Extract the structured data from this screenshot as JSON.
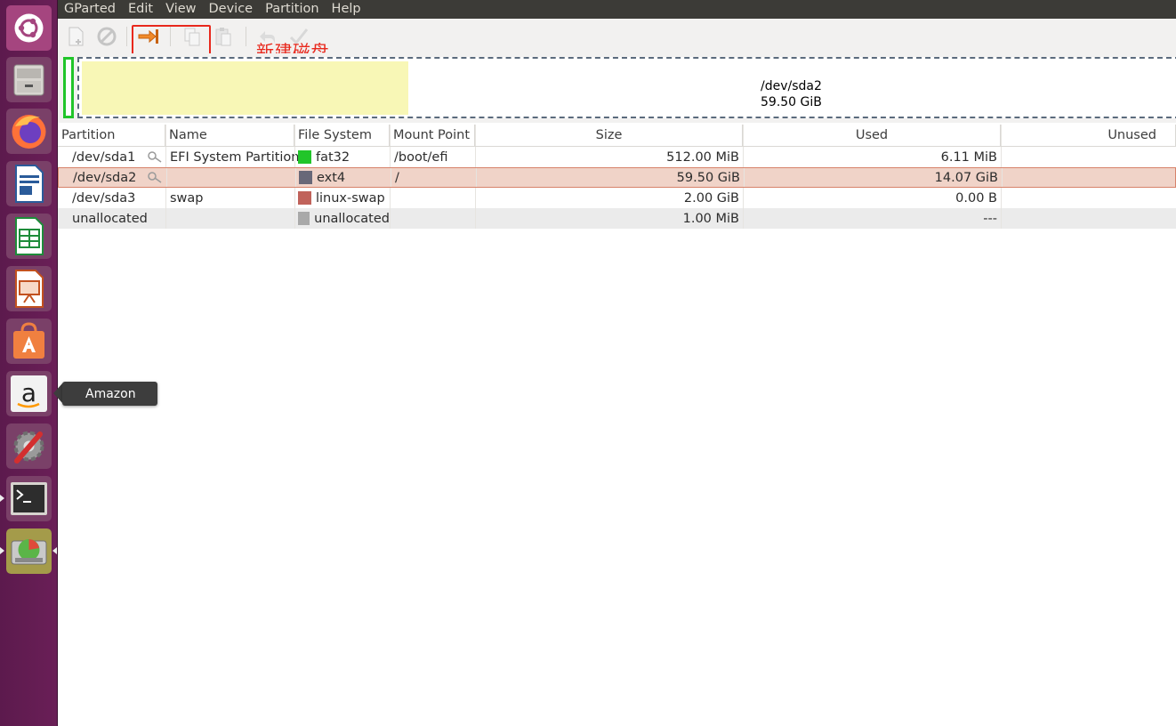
{
  "menubar": {
    "app": "GParted",
    "items": [
      "Edit",
      "View",
      "Device",
      "Partition",
      "Help"
    ]
  },
  "toolbar": {
    "buttons": [
      {
        "name": "new-partition",
        "enabled": false
      },
      {
        "name": "delete-partition",
        "enabled": false
      },
      {
        "name": "resize-move",
        "enabled": true
      },
      {
        "name": "copy",
        "enabled": false
      },
      {
        "name": "paste",
        "enabled": false
      },
      {
        "name": "undo",
        "enabled": false
      },
      {
        "name": "apply",
        "enabled": false
      }
    ],
    "annotation": "新建磁盘",
    "annotation_color": "#e8281c"
  },
  "diskmap": {
    "selected_partition": "/dev/sda2",
    "selected_size": "59.50 GiB"
  },
  "table": {
    "headers": {
      "partition": "Partition",
      "name": "Name",
      "filesystem": "File System",
      "mountpoint": "Mount Point",
      "size": "Size",
      "used": "Used",
      "unused": "Unused"
    },
    "rows": [
      {
        "partition": "/dev/sda1",
        "name": "EFI System Partition",
        "filesystem": "fat32",
        "fs_color": "#21c52a",
        "mountpoint": "/boot/efi",
        "size": "512.00 MiB",
        "used": "6.11 MiB",
        "unused": "",
        "locked": true
      },
      {
        "partition": "/dev/sda2",
        "name": "",
        "filesystem": "ext4",
        "fs_color": "#686878",
        "mountpoint": "/",
        "size": "59.50 GiB",
        "used": "14.07 GiB",
        "unused": "",
        "locked": true,
        "selected": true
      },
      {
        "partition": "/dev/sda3",
        "name": "swap",
        "filesystem": "linux-swap",
        "fs_color": "#c0625a",
        "mountpoint": "",
        "size": "2.00 GiB",
        "used": "0.00 B",
        "unused": "",
        "locked": false
      },
      {
        "partition": "unallocated",
        "name": "",
        "filesystem": "unallocated",
        "fs_color": "#a9a9a9",
        "mountpoint": "",
        "size": "1.00 MiB",
        "used": "---",
        "unused": "",
        "locked": false
      }
    ]
  },
  "launcher": {
    "items": [
      "dash-home",
      "files",
      "firefox",
      "libreoffice-writer",
      "libreoffice-calc",
      "libreoffice-impress",
      "ubuntu-software",
      "amazon",
      "system-settings",
      "terminal",
      "gparted"
    ],
    "tooltip": "Amazon"
  },
  "colors": {
    "launcher_bg": "#5e1a4a",
    "menubar_bg": "#3c3b37",
    "selection_bg": "#f0d3c8",
    "ext4_used": "#f8f7b6"
  }
}
